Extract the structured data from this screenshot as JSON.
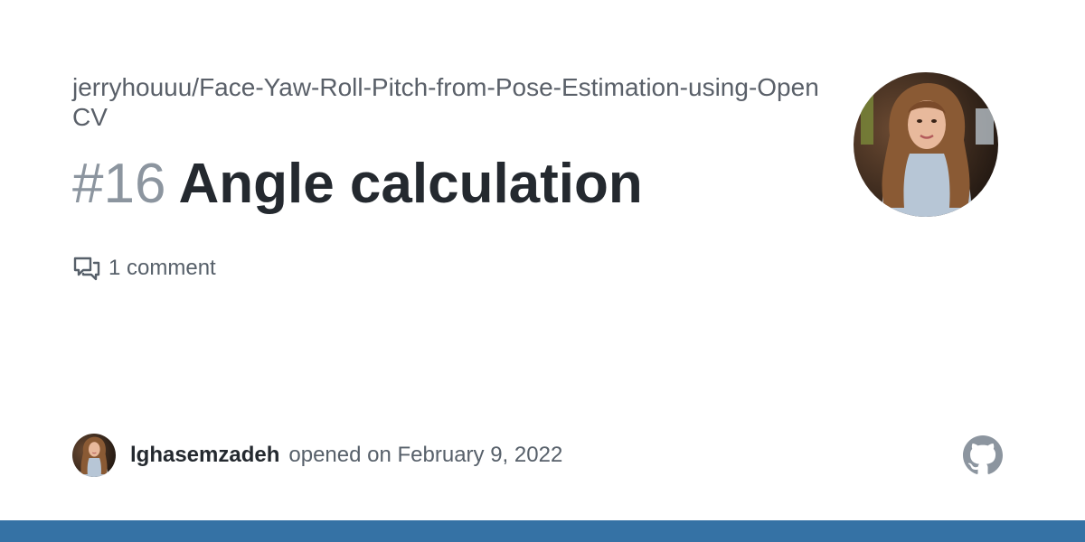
{
  "repo": {
    "full_name": "jerryhouuu/Face-Yaw-Roll-Pitch-from-Pose-Estimation-using-OpenCV"
  },
  "issue": {
    "number": "#16",
    "title": "Angle calculation"
  },
  "stats": {
    "comments_label": "1 comment",
    "comments_icon": "comment-discussion-icon"
  },
  "footer": {
    "author": "lghasemzadeh",
    "opened_text": "opened on February 9, 2022",
    "logo_icon": "github-mark-icon"
  },
  "colors": {
    "bottom_bar": "#3572a5",
    "github_logo": "#8c959f",
    "title": "#24292f",
    "issue_number": "#8c959f",
    "muted_text": "#57606a"
  }
}
